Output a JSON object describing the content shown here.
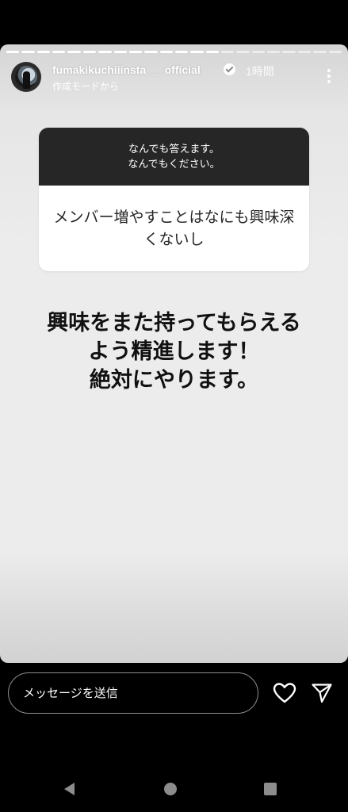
{
  "story": {
    "segments_total": 22,
    "segments_viewed": 14,
    "header": {
      "username": "fumakikuchiiinsta___official",
      "time": "1時間",
      "subtitle": "作成モードから"
    },
    "question_sticker": {
      "prompt_line1": "なんでも答えます。",
      "prompt_line2": "なんでもください。",
      "answer": "メンバー増やすことはなにも興味深くないし"
    },
    "caption": {
      "line1": "興味をまた持ってもらえる",
      "line2": "よう精進します！",
      "line3": "絶対にやります。"
    }
  },
  "reply_bar": {
    "placeholder": "メッセージを送信",
    "like_icon": "heart-icon",
    "send_icon": "send-icon"
  },
  "system_nav": {
    "back_icon": "back-triangle-icon",
    "home_icon": "home-circle-icon",
    "recents_icon": "recents-square-icon"
  },
  "colors": {
    "sticker_header": "#262626",
    "sticker_body": "#ffffff",
    "story_background": "#ececec"
  }
}
